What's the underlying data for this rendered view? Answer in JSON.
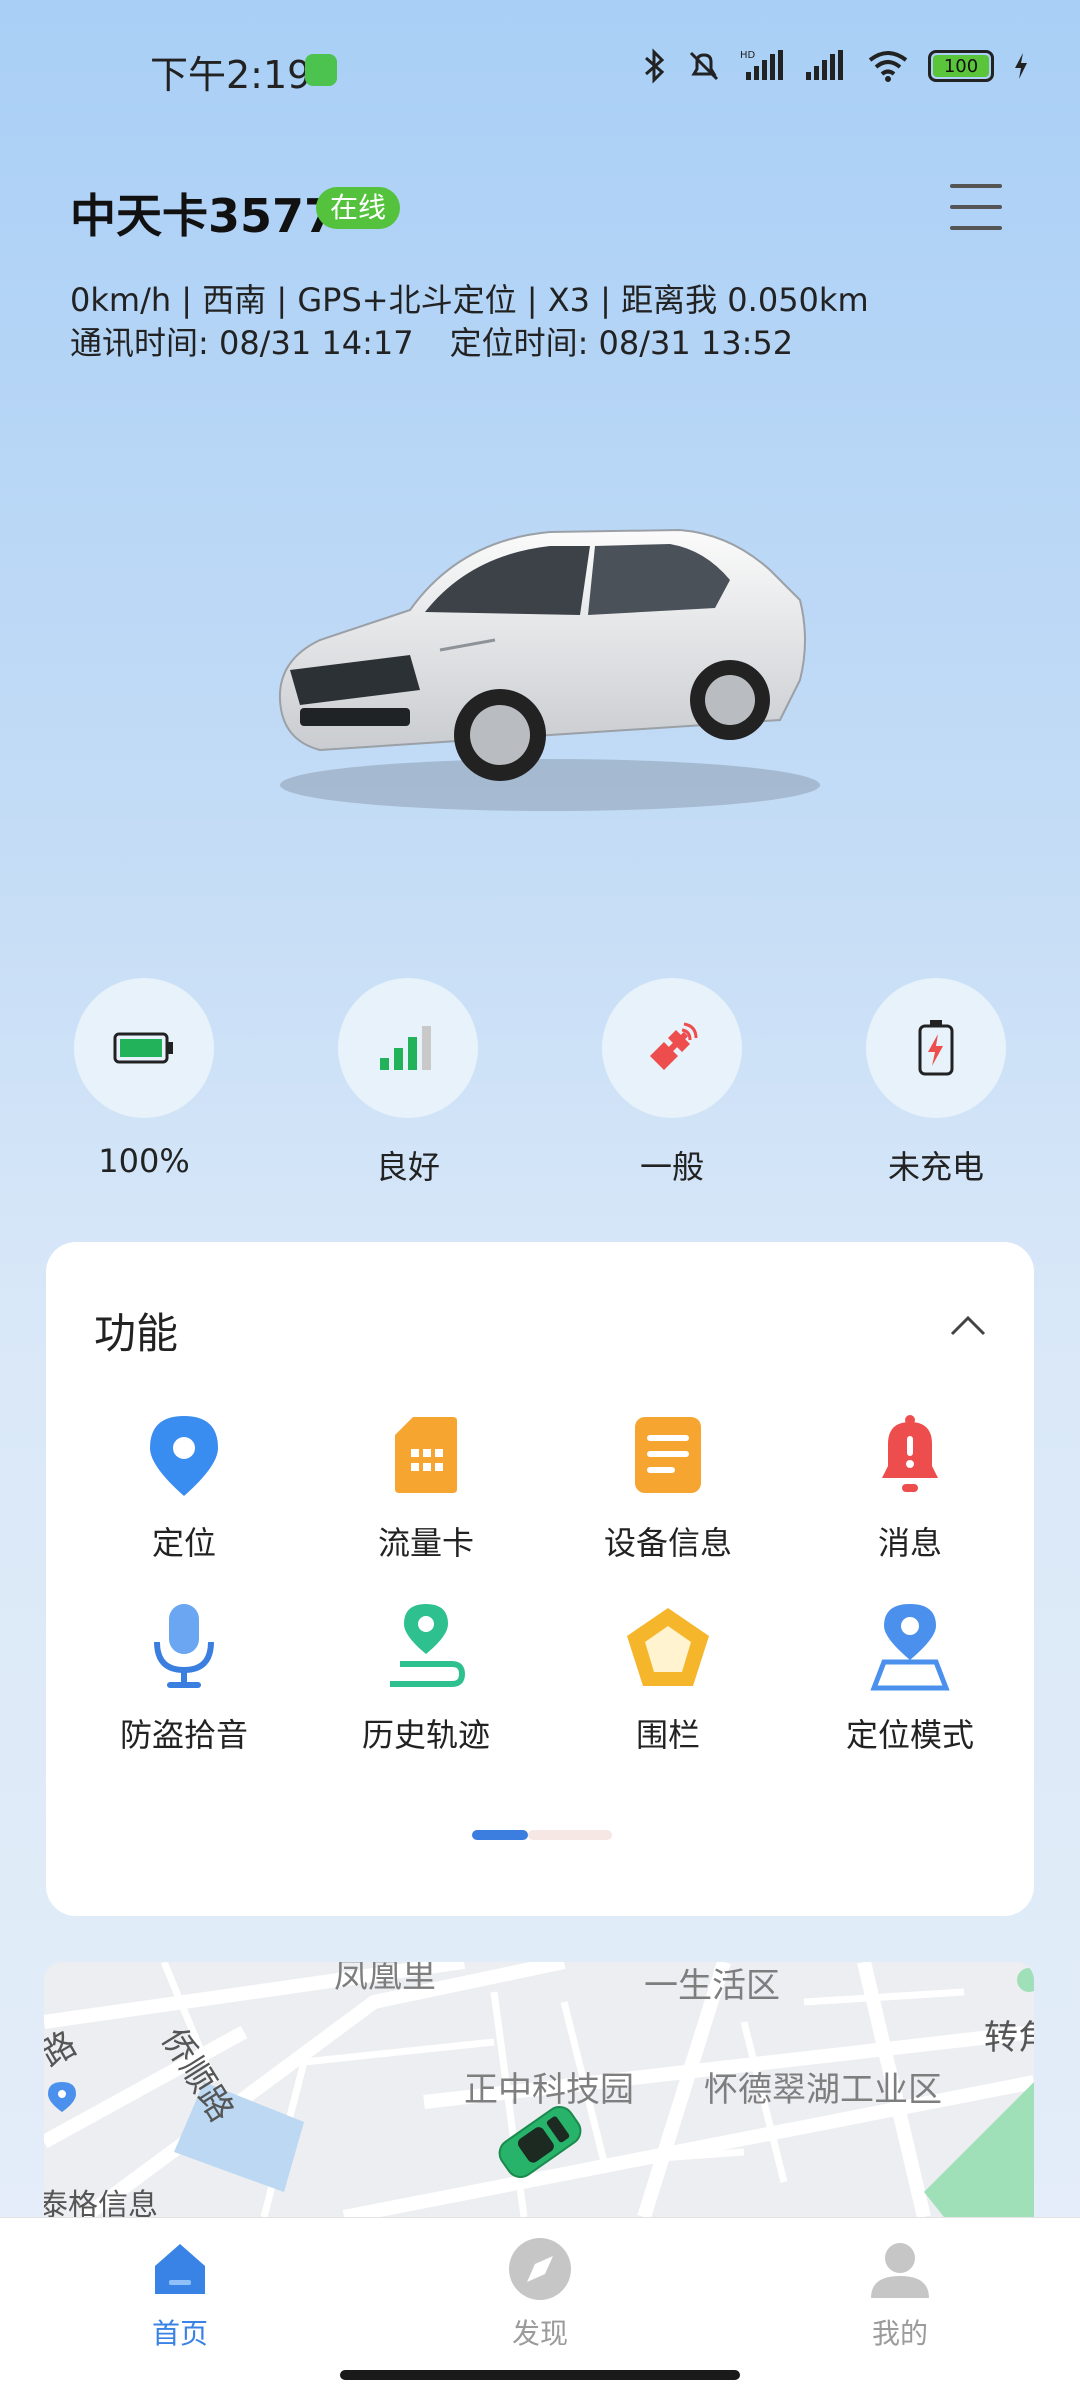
{
  "status_bar": {
    "time": "下午2:19",
    "battery": "100"
  },
  "device": {
    "name": "中天卡3577",
    "online_status": "在线",
    "info_line1": "0km/h | 西南 | GPS+北斗定位 | X3 | 距离我 0.050km",
    "comm_time": "通讯时间: 08/31 14:17",
    "locate_time": "定位时间: 08/31 13:52"
  },
  "stats": [
    {
      "label": "100%",
      "icon": "battery-icon"
    },
    {
      "label": "良好",
      "icon": "signal-icon"
    },
    {
      "label": "一般",
      "icon": "satellite-icon"
    },
    {
      "label": "未充电",
      "icon": "charging-icon"
    }
  ],
  "functions": {
    "title": "功能",
    "items": [
      {
        "label": "定位",
        "icon": "location-pin-icon"
      },
      {
        "label": "流量卡",
        "icon": "sim-card-icon"
      },
      {
        "label": "设备信息",
        "icon": "device-info-icon"
      },
      {
        "label": "消息",
        "icon": "bell-icon"
      },
      {
        "label": "防盗拾音",
        "icon": "microphone-icon"
      },
      {
        "label": "历史轨迹",
        "icon": "track-icon"
      },
      {
        "label": "围栏",
        "icon": "fence-icon"
      },
      {
        "label": "定位模式",
        "icon": "location-mode-icon"
      }
    ],
    "page_index": 1,
    "page_count": 2
  },
  "map": {
    "labels": [
      "凤凰里",
      "一生活区",
      "转角",
      "侨顺路",
      "路",
      "正中科技园",
      "怀德翠湖工业区",
      "泰格信息"
    ]
  },
  "nav": [
    {
      "label": "首页",
      "icon": "home-icon",
      "active": true
    },
    {
      "label": "发现",
      "icon": "compass-icon",
      "active": false
    },
    {
      "label": "我的",
      "icon": "profile-icon",
      "active": false
    }
  ],
  "colors": {
    "accent": "#3a83e6",
    "online": "#55c23e",
    "battery_green": "#21b25a",
    "alert_red": "#ee4d4d",
    "orange": "#f6a531"
  }
}
